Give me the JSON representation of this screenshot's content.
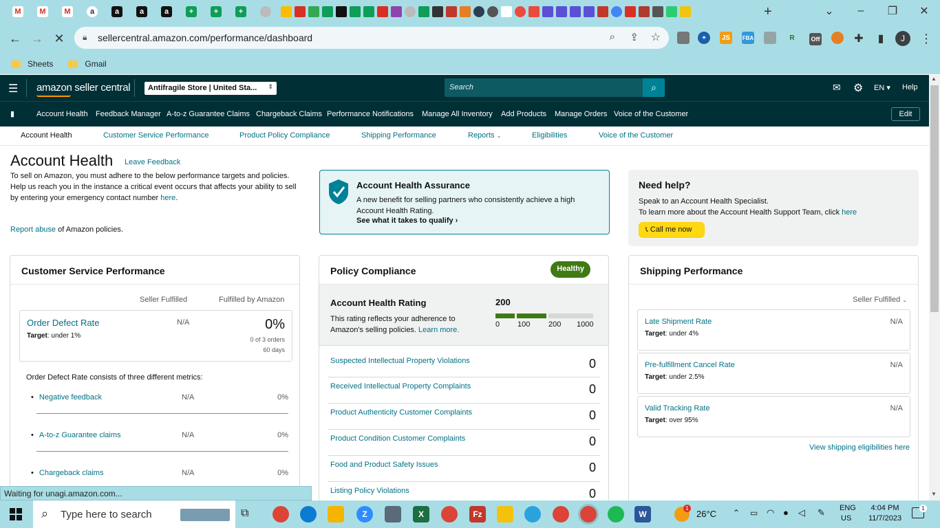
{
  "browser": {
    "url": "sellercentral.amazon.com/performance/dashboard",
    "bookmarks": [
      "Sheets",
      "Gmail"
    ],
    "status_text": "Waiting for unagi.amazon.com...",
    "profile_initial": "J",
    "ext_off_badge": "Off"
  },
  "header": {
    "logo": "amazon seller central",
    "store_selector": "Antifragile Store | United Sta...",
    "search_placeholder": "Search",
    "language": "EN",
    "help": "Help"
  },
  "nav": {
    "items": [
      "Account Health",
      "Feedback Manager",
      "A-to-z Guarantee Claims",
      "Chargeback Claims",
      "Performance Notifications",
      "Manage All Inventory",
      "Add Products",
      "Manage Orders",
      "Voice of the Customer"
    ],
    "edit": "Edit"
  },
  "subnav": {
    "items": [
      "Account Health",
      "Customer Service Performance",
      "Product Policy Compliance",
      "Shipping Performance",
      "Reports",
      "Eligibilities",
      "Voice of the Customer"
    ]
  },
  "intro": {
    "title": "Account Health",
    "feedback_link": "Leave Feedback",
    "p1": "To sell on Amazon, you must adhere to the below performance targets and policies.",
    "p2_a": "Help us reach you in the instance a critical event occurs that affects your ability to sell by entering your emergency contact number ",
    "p2_link": "here",
    "p2_b": ".",
    "report_link": "Report abuse",
    "report_rest": " of Amazon policies."
  },
  "assurance": {
    "title": "Account Health Assurance",
    "text": "A new benefit for selling partners who consistently achieve a high Account Health Rating.",
    "cta": "See what it takes to qualify"
  },
  "help": {
    "title": "Need help?",
    "line1": "Speak to an Account Health Specialist.",
    "line2": "To learn more about the Account Health Support Team, click ",
    "line2_link": "here",
    "button": "Call me now"
  },
  "customer_service": {
    "title": "Customer Service Performance",
    "col1": "Seller Fulfilled",
    "col2": "Fulfilled by Amazon",
    "odr_label": "Order Defect Rate",
    "odr_target_label": "Target",
    "odr_target": ": under 1%",
    "odr_sf": "N/A",
    "odr_fba": "0%",
    "odr_orders": "0 of 3 orders",
    "odr_days": "60 days",
    "metrics_intro": "Order Defect Rate consists of three different metrics:",
    "metrics": [
      {
        "label": "Negative feedback",
        "sf": "N/A",
        "fba": "0%"
      },
      {
        "label": "A-to-z Guarantee claims",
        "sf": "N/A",
        "fba": "0%"
      },
      {
        "label": "Chargeback claims",
        "sf": "N/A",
        "fba": "0%"
      }
    ]
  },
  "policy": {
    "title": "Policy Compliance",
    "badge": "Healthy",
    "badge_color": "#3f7a14",
    "ahr_title": "Account Health Rating",
    "ahr_text": "This rating reflects your adherence to Amazon's selling policies. ",
    "ahr_link": "Learn more.",
    "ahr_value": "200",
    "scale": [
      "0",
      "100",
      "200",
      "1000"
    ],
    "rows": [
      {
        "label": "Suspected Intellectual Property Violations",
        "value": "0"
      },
      {
        "label": "Received Intellectual Property Complaints",
        "value": "0"
      },
      {
        "label": "Product Authenticity Customer Complaints",
        "value": "0"
      },
      {
        "label": "Product Condition Customer Complaints",
        "value": "0"
      },
      {
        "label": "Food and Product Safety Issues",
        "value": "0"
      },
      {
        "label": "Listing Policy Violations",
        "value": "0"
      }
    ]
  },
  "shipping": {
    "title": "Shipping Performance",
    "filter": "Seller Fulfilled",
    "metrics": [
      {
        "label": "Late Shipment Rate",
        "target": ": under 4%",
        "value": "N/A"
      },
      {
        "label": "Pre-fulfillment Cancel Rate",
        "target": ": under 2.5%",
        "value": "N/A"
      },
      {
        "label": "Valid Tracking Rate",
        "target": ": over 95%",
        "value": "N/A"
      }
    ],
    "target_label": "Target",
    "footer_link": "View shipping eligibilities here"
  },
  "taskbar": {
    "search": "Type here to search",
    "temp": "26°C",
    "lang1": "ENG",
    "lang2": "US",
    "time": "4:04 PM",
    "date": "11/7/2023",
    "notif_count": "1",
    "weather_badge": "1"
  }
}
